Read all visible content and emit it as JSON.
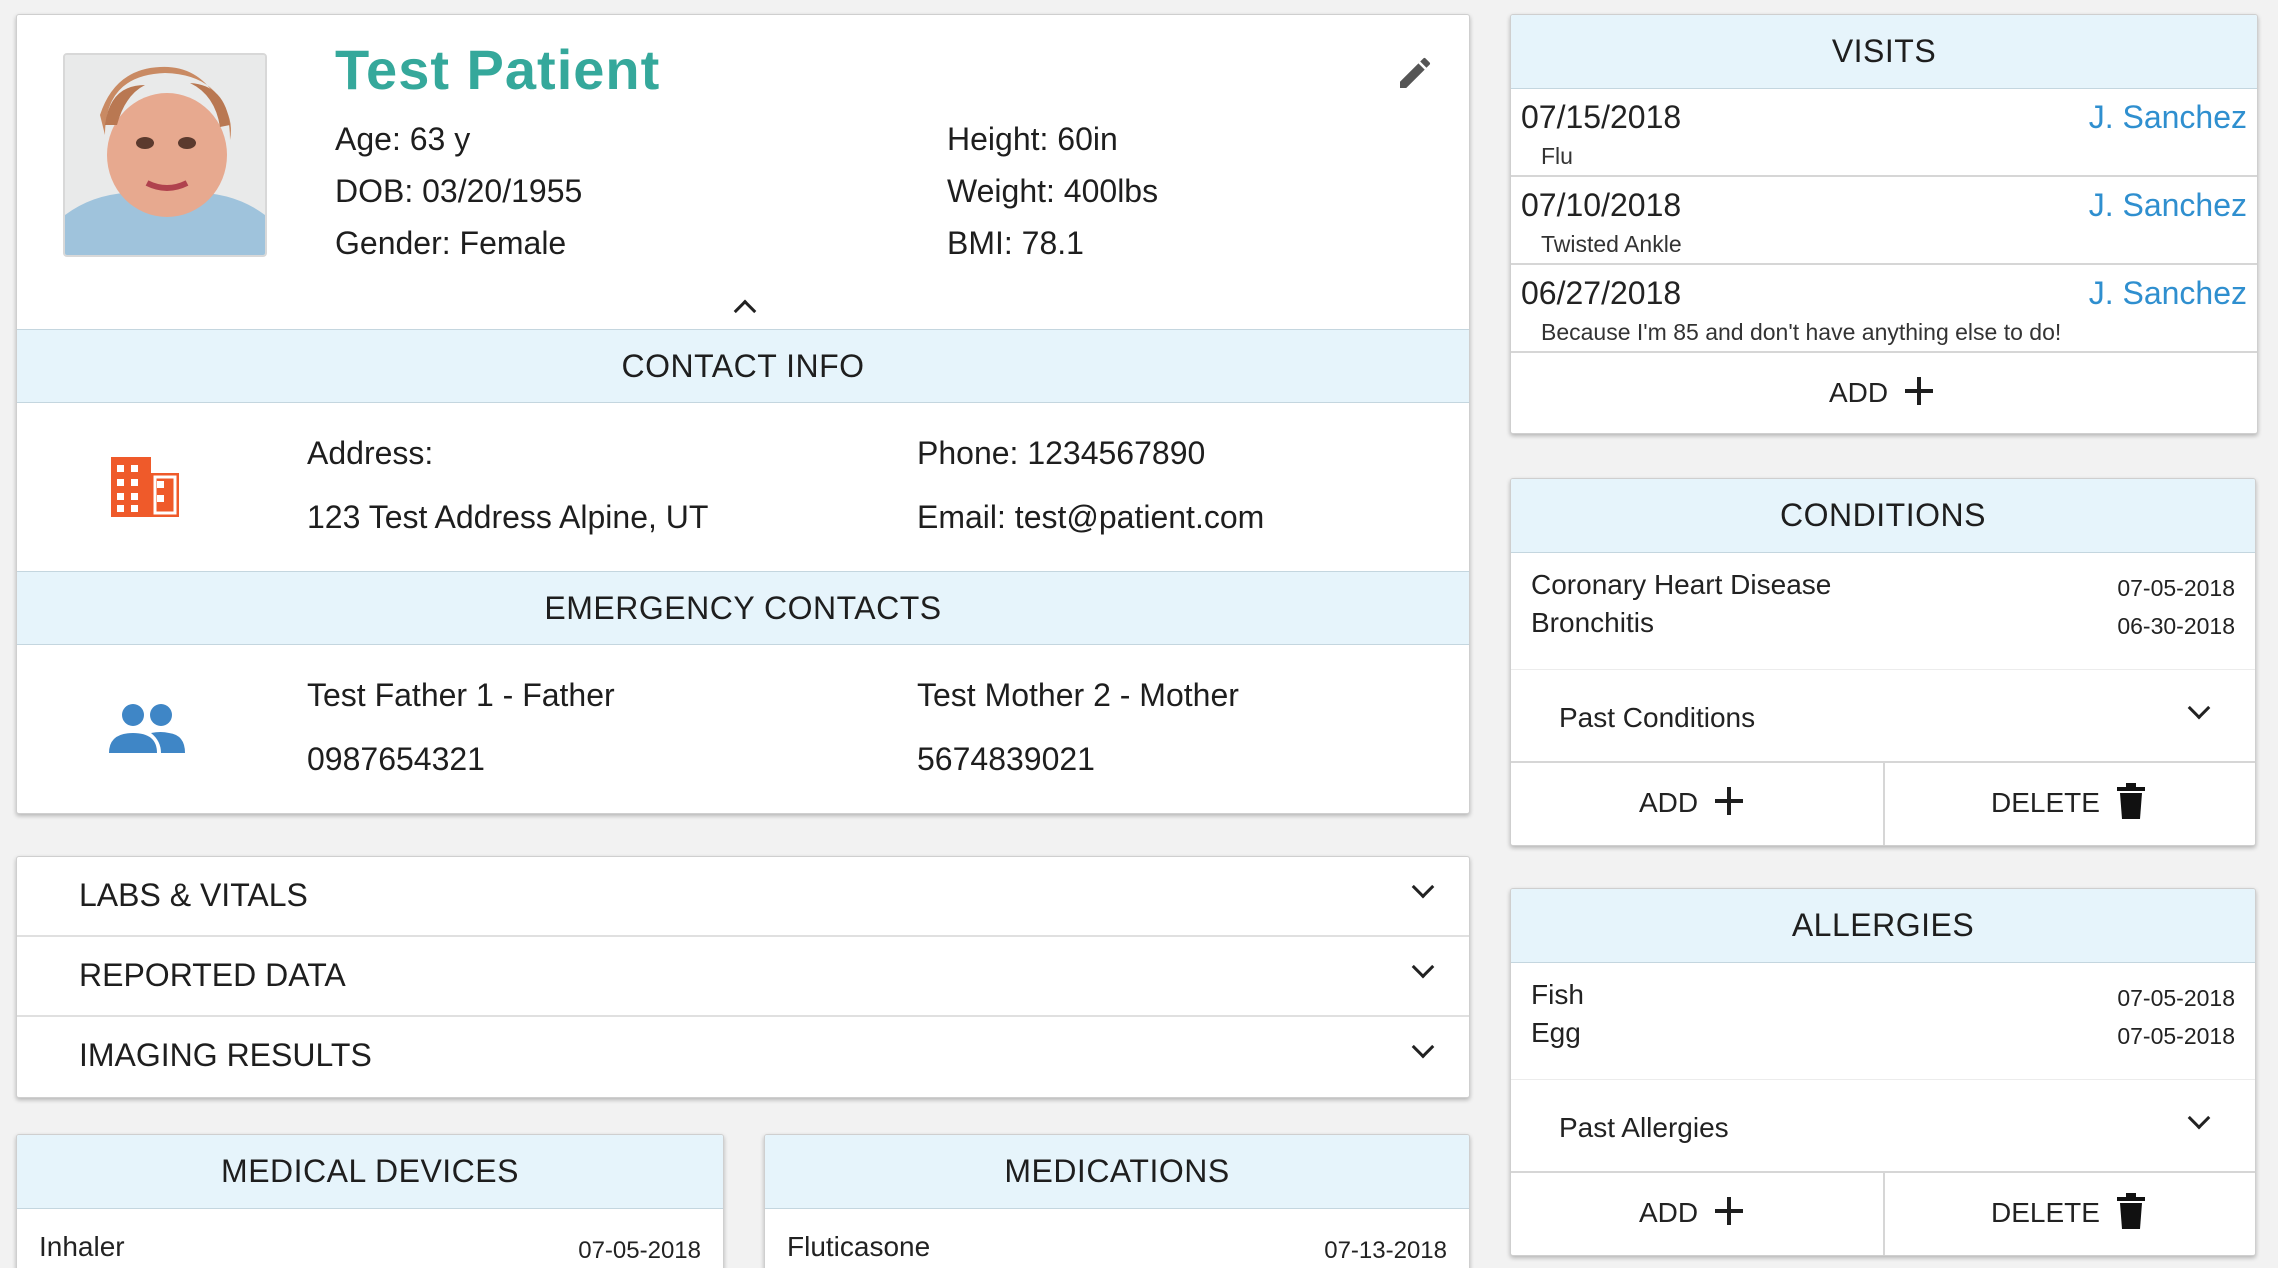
{
  "patient": {
    "name": "Test Patient",
    "age": "Age: 63 y",
    "dob": "DOB: 03/20/1955",
    "gender": "Gender: Female",
    "height": "Height: 60in",
    "weight": "Weight: 400lbs",
    "bmi": "BMI: 78.1"
  },
  "contact": {
    "title": "CONTACT INFO",
    "address_label": "Address:",
    "address": "123 Test Address Alpine, UT",
    "phone": "Phone: 1234567890",
    "email": "Email: test@patient.com"
  },
  "emergency": {
    "title": "EMERGENCY CONTACTS",
    "contacts": [
      {
        "name": "Test Father 1 - Father",
        "phone": "0987654321"
      },
      {
        "name": "Test Mother 2 - Mother",
        "phone": "5674839021"
      }
    ]
  },
  "sections": [
    {
      "label": "LABS & VITALS"
    },
    {
      "label": "REPORTED DATA"
    },
    {
      "label": "IMAGING RESULTS"
    }
  ],
  "devices": {
    "title": "MEDICAL DEVICES",
    "items": [
      {
        "name": "Inhaler",
        "date": "07-05-2018"
      }
    ]
  },
  "medications": {
    "title": "MEDICATIONS",
    "items": [
      {
        "name": "Fluticasone",
        "date": "07-13-2018"
      }
    ]
  },
  "visits": {
    "title": "VISITS",
    "items": [
      {
        "date": "07/15/2018",
        "provider": "J. Sanchez",
        "reason": "Flu"
      },
      {
        "date": "07/10/2018",
        "provider": "J. Sanchez",
        "reason": "Twisted Ankle"
      },
      {
        "date": "06/27/2018",
        "provider": "J. Sanchez",
        "reason": "Because I'm 85 and don't have anything else to do!"
      }
    ],
    "add_label": "ADD"
  },
  "conditions": {
    "title": "CONDITIONS",
    "items": [
      {
        "name": "Coronary Heart Disease",
        "date": "07-05-2018"
      },
      {
        "name": "Bronchitis",
        "date": "06-30-2018"
      }
    ],
    "past_label": "Past Conditions",
    "add_label": "ADD",
    "delete_label": "DELETE"
  },
  "allergies": {
    "title": "ALLERGIES",
    "items": [
      {
        "name": "Fish",
        "date": "07-05-2018"
      },
      {
        "name": "Egg",
        "date": "07-05-2018"
      }
    ],
    "past_label": "Past Allergies",
    "add_label": "ADD",
    "delete_label": "DELETE"
  },
  "colors": {
    "accent": "#35a89b",
    "link": "#2f8fcf",
    "header_band": "#e6f4fb",
    "building_icon": "#ef5a2a",
    "people_icon": "#3f86c6"
  },
  "icons": [
    "pencil-icon",
    "building-icon",
    "people-icon",
    "chevron-down-icon",
    "chevron-up-icon",
    "plus-icon",
    "trash-icon"
  ]
}
